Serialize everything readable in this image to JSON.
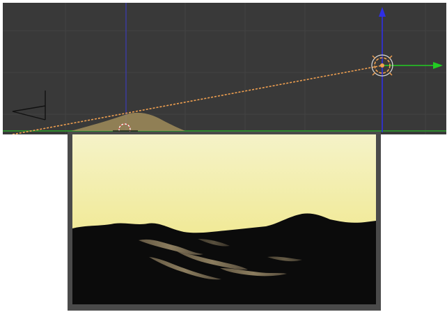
{
  "viewport": {
    "background_color": "#393939",
    "grid_color": "#424242",
    "horizon_color": "#2f8a2f",
    "vertical_axis_color": "#3a3ad0",
    "z_axis_color": "#2f2fe6",
    "y_axis_color": "#22cc22",
    "selection_color": "#f0a050",
    "terrain_color": "#a08c5a",
    "icons": {
      "camera": "camera-icon",
      "lamp": "lamp-icon",
      "cursor": "3d-cursor-icon"
    }
  },
  "render": {
    "frame_color": "#4a4a4a",
    "sky_top_color": "#f5f3c8",
    "sky_horizon_color": "#f0e88a",
    "terrain_color": "#0a0a0a",
    "highlight_color": "#8a7a5c"
  }
}
